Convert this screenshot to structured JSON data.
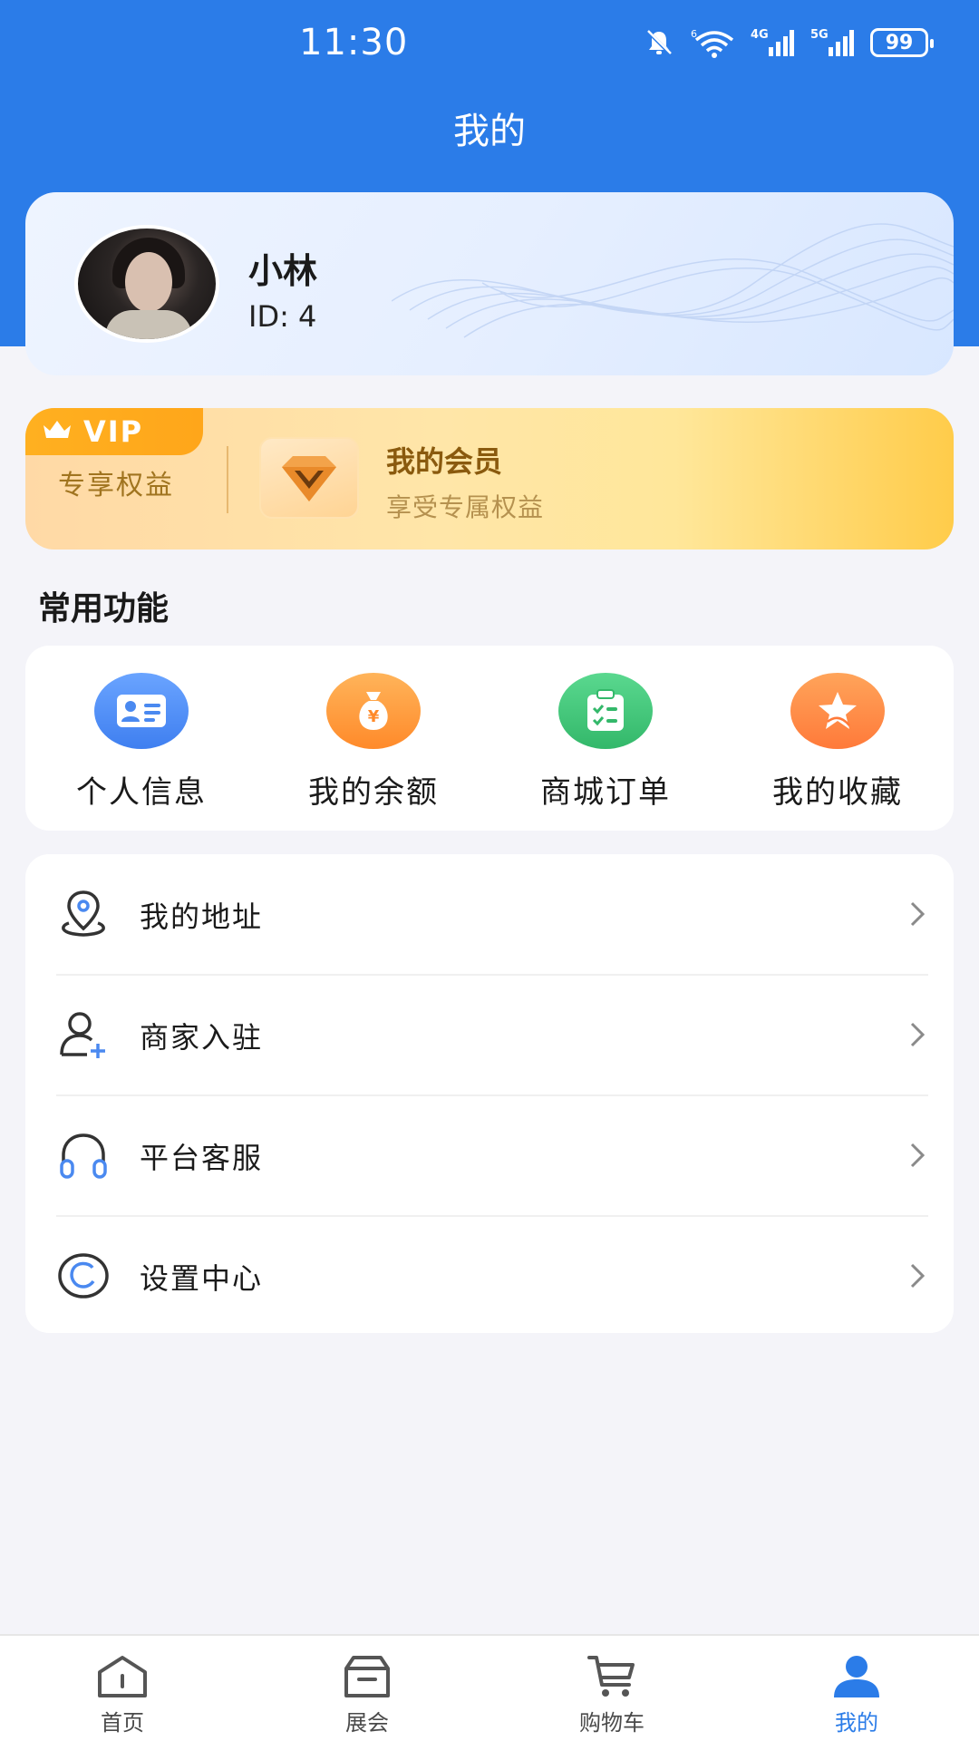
{
  "status_bar": {
    "time": "11:30",
    "battery": "99",
    "icons": [
      "mute-icon",
      "wifi-icon",
      "signal-4g-icon",
      "signal-5g-icon",
      "battery-icon"
    ]
  },
  "header": {
    "title": "我的"
  },
  "profile": {
    "name": "小林",
    "id_text": "ID: 4"
  },
  "vip": {
    "tag": "VIP",
    "sub": "专享权益",
    "title": "我的会员",
    "desc": "享受专属权益"
  },
  "functions": {
    "title": "常用功能",
    "items": [
      {
        "label": "个人信息",
        "icon": "id-card-icon",
        "color": "#4a89f0"
      },
      {
        "label": "我的余额",
        "icon": "money-bag-icon",
        "color": "#ff9a3a"
      },
      {
        "label": "商城订单",
        "icon": "order-clipboard-icon",
        "color": "#3ec57a"
      },
      {
        "label": "我的收藏",
        "icon": "star-icon",
        "color": "#ff8a4a"
      }
    ]
  },
  "menu": {
    "items": [
      {
        "label": "我的地址",
        "icon": "location-pin-icon"
      },
      {
        "label": "商家入驻",
        "icon": "user-add-icon"
      },
      {
        "label": "平台客服",
        "icon": "headphones-icon"
      },
      {
        "label": "设置中心",
        "icon": "copyright-circle-icon"
      }
    ]
  },
  "tabs": [
    {
      "label": "首页",
      "icon": "home-icon"
    },
    {
      "label": "展会",
      "icon": "exhibition-box-icon"
    },
    {
      "label": "购物车",
      "icon": "cart-icon"
    },
    {
      "label": "我的",
      "icon": "user-icon",
      "active": true
    }
  ],
  "colors": {
    "primary": "#2b7ce8",
    "background": "#f4f4f9",
    "vip_gold": "#ffb020"
  }
}
